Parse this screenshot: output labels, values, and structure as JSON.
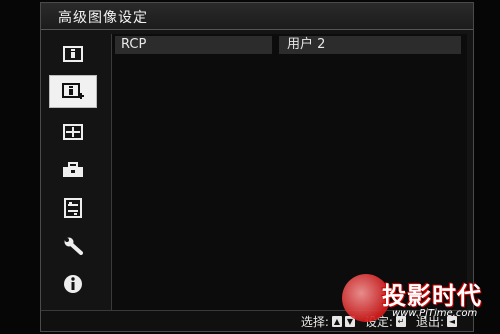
{
  "window": {
    "title": "高级图像设定"
  },
  "sidebar": {
    "items": [
      {
        "icon": "picture-info-icon",
        "active": false
      },
      {
        "icon": "advanced-picture-icon",
        "active": true
      },
      {
        "icon": "screen-layout-icon",
        "active": false
      },
      {
        "icon": "toolbox-icon",
        "active": false
      },
      {
        "icon": "list-settings-icon",
        "active": false
      },
      {
        "icon": "wrench-icon",
        "active": false
      },
      {
        "icon": "info-icon",
        "active": false
      }
    ]
  },
  "settings": {
    "rows": [
      {
        "label": "RCP",
        "value": "用户 2"
      }
    ]
  },
  "footer": {
    "select_label": "选择:",
    "set_label": "设定:",
    "exit_label": "退出:"
  },
  "watermark": {
    "text": "投影时代",
    "url": "www.PjTime.com"
  },
  "colors": {
    "background": "#060606",
    "panel": "#141414",
    "row": "#2c2c2c",
    "active_item": "#f1f1f1",
    "watermark_red": "#d81b1b"
  }
}
